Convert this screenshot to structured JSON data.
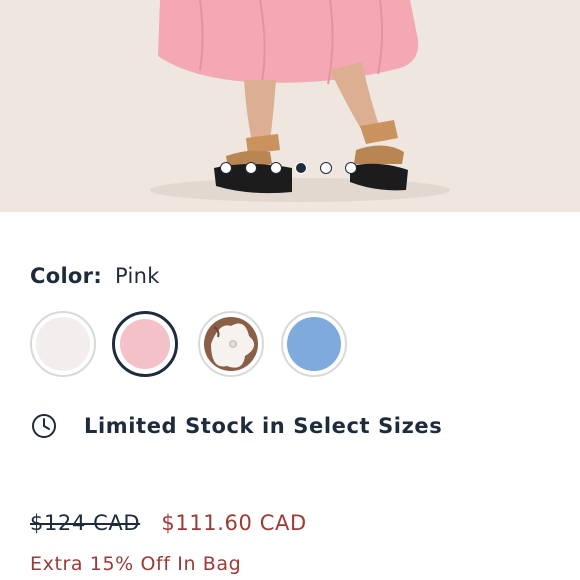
{
  "product_image": {
    "alt": "",
    "carousel": {
      "count": 6,
      "active_index": 3
    }
  },
  "color_selector": {
    "label": "Color:",
    "selected_value": "Pink",
    "swatches": [
      {
        "name": "white",
        "color": "#f2eeee"
      },
      {
        "name": "pink",
        "color": "#f4c1c8",
        "selected": true
      },
      {
        "name": "floral",
        "color": "#8b5e48"
      },
      {
        "name": "blue",
        "color": "#7eabdc"
      }
    ]
  },
  "stock": {
    "icon": "clock-icon",
    "text": "Limited Stock in Select Sizes"
  },
  "pricing": {
    "original_price": "$124 CAD",
    "sale_price": "$111.60 CAD",
    "promo_text": "Extra 15% Off In Bag"
  },
  "colors": {
    "navy": "#1d2b3a",
    "sale_red": "#9b3a36",
    "backdrop": "#eee6df"
  }
}
